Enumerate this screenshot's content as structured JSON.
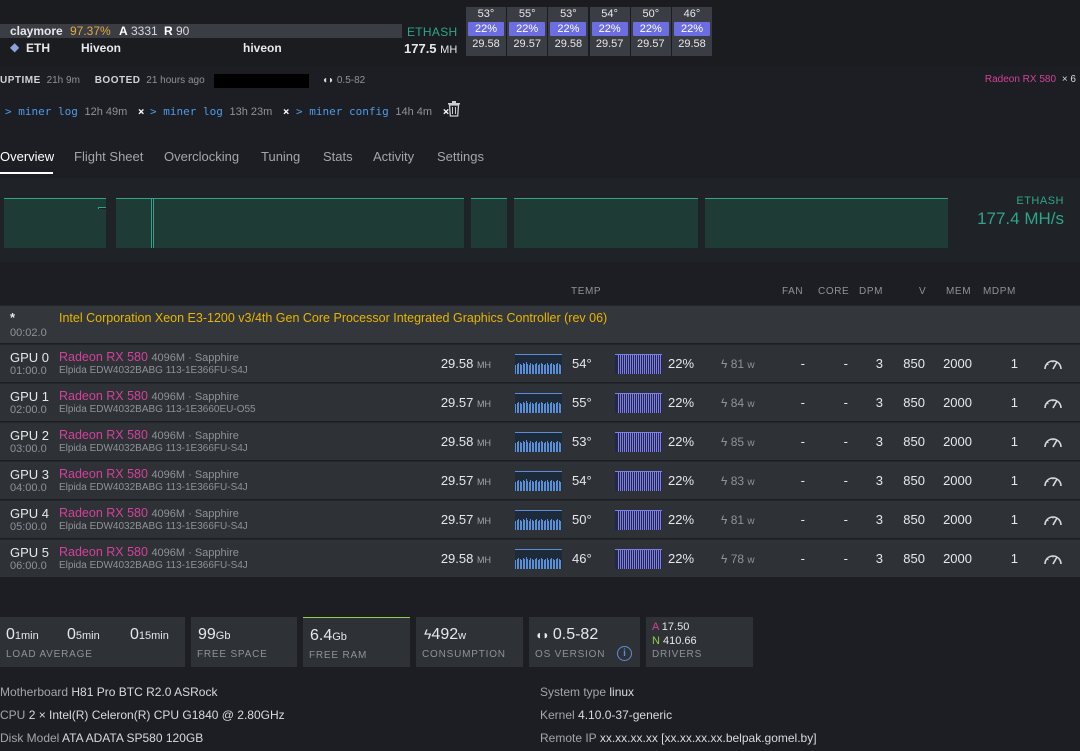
{
  "header": {
    "miner": "claymore",
    "miner_pct": "97.37%",
    "accepted_label": "A",
    "accepted": "3331",
    "rejected_label": "R",
    "rejected": "90",
    "coin": "ETH",
    "pool": "Hiveon",
    "wallet": "hiveon",
    "algo": "ETHASH",
    "hashrate": "177.5",
    "hashrate_unit": "MH"
  },
  "gpu_cards": [
    {
      "temp": "53°",
      "fan": "22%",
      "hash": "29.58"
    },
    {
      "temp": "55°",
      "fan": "22%",
      "hash": "29.57"
    },
    {
      "temp": "53°",
      "fan": "22%",
      "hash": "29.58"
    },
    {
      "temp": "54°",
      "fan": "22%",
      "hash": "29.57"
    },
    {
      "temp": "50°",
      "fan": "22%",
      "hash": "29.57"
    },
    {
      "temp": "46°",
      "fan": "22%",
      "hash": "29.58"
    }
  ],
  "status": {
    "uptime_label": "UPTIME",
    "uptime": "21h 9m",
    "booted_label": "BOOTED",
    "booted": "21 hours ago",
    "version": "0.5-82",
    "gpu_model": "Radeon RX 580",
    "gpu_count": "× 6"
  },
  "commands": [
    {
      "prefix": ">",
      "name": "miner log",
      "age": "12h 49m",
      "close": "×"
    },
    {
      "prefix": ">",
      "name": "miner log",
      "age": "13h 23m",
      "close": "×"
    },
    {
      "prefix": ">",
      "name": "miner config",
      "age": "14h 4m",
      "close": "×"
    }
  ],
  "tabs": [
    "Overview",
    "Flight Sheet",
    "Overclocking",
    "Tuning",
    "Stats",
    "Activity",
    "Settings"
  ],
  "hash_chart": {
    "algo": "ETHASH",
    "value": "177.4 MH/s"
  },
  "gpu_table": {
    "headers": {
      "temp": "TEMP",
      "fan": "FAN",
      "core": "CORE",
      "dpm": "DPM",
      "v": "V",
      "mem": "MEM",
      "mdpm": "MDPM"
    },
    "igpu": {
      "star": "*",
      "bus": "00:02.0",
      "name": "Intel Corporation Xeon E3-1200 v3/4th Gen Core Processor Integrated Graphics Controller (rev 06)"
    },
    "rows": [
      {
        "name": "GPU 0",
        "bus": "01:00.0",
        "model": "Radeon RX 580",
        "sub": "4096M · Sapphire",
        "mem": "Elpida EDW4032BABG 113-1E366FU-S4J",
        "hash": "29.58",
        "unit": "MH",
        "temp": "54°",
        "fan": "22%",
        "power": "81",
        "power_unit": "w",
        "fan_col": "-",
        "core_col": "-",
        "dpm": "3",
        "v": "850",
        "memclk": "2000",
        "mdpm": "1"
      },
      {
        "name": "GPU 1",
        "bus": "02:00.0",
        "model": "Radeon RX 580",
        "sub": "4096M · Sapphire",
        "mem": "Elpida EDW4032BABG 113-1E3660EU-O55",
        "hash": "29.57",
        "unit": "MH",
        "temp": "55°",
        "fan": "22%",
        "power": "84",
        "power_unit": "w",
        "fan_col": "-",
        "core_col": "-",
        "dpm": "3",
        "v": "850",
        "memclk": "2000",
        "mdpm": "1"
      },
      {
        "name": "GPU 2",
        "bus": "03:00.0",
        "model": "Radeon RX 580",
        "sub": "4096M · Sapphire",
        "mem": "Elpida EDW4032BABG 113-1E366FU-S4J",
        "hash": "29.58",
        "unit": "MH",
        "temp": "53°",
        "fan": "22%",
        "power": "85",
        "power_unit": "w",
        "fan_col": "-",
        "core_col": "-",
        "dpm": "3",
        "v": "850",
        "memclk": "2000",
        "mdpm": "1"
      },
      {
        "name": "GPU 3",
        "bus": "04:00.0",
        "model": "Radeon RX 580",
        "sub": "4096M · Sapphire",
        "mem": "Elpida EDW4032BABG 113-1E366FU-S4J",
        "hash": "29.57",
        "unit": "MH",
        "temp": "54°",
        "fan": "22%",
        "power": "83",
        "power_unit": "w",
        "fan_col": "-",
        "core_col": "-",
        "dpm": "3",
        "v": "850",
        "memclk": "2000",
        "mdpm": "1"
      },
      {
        "name": "GPU 4",
        "bus": "05:00.0",
        "model": "Radeon RX 580",
        "sub": "4096M · Sapphire",
        "mem": "Elpida EDW4032BABG 113-1E366FU-S4J",
        "hash": "29.57",
        "unit": "MH",
        "temp": "50°",
        "fan": "22%",
        "power": "81",
        "power_unit": "w",
        "fan_col": "-",
        "core_col": "-",
        "dpm": "3",
        "v": "850",
        "memclk": "2000",
        "mdpm": "1"
      },
      {
        "name": "GPU 5",
        "bus": "06:00.0",
        "model": "Radeon RX 580",
        "sub": "4096M · Sapphire",
        "mem": "Elpida EDW4032BABG 113-1E366FU-S4J",
        "hash": "29.58",
        "unit": "MH",
        "temp": "46°",
        "fan": "22%",
        "power": "78",
        "power_unit": "w",
        "fan_col": "-",
        "core_col": "-",
        "dpm": "3",
        "v": "850",
        "memclk": "2000",
        "mdpm": "1"
      }
    ]
  },
  "stats": {
    "load": [
      {
        "value": "0",
        "unit": "1min"
      },
      {
        "value": "0",
        "unit": "5min"
      },
      {
        "value": "0",
        "unit": "15min"
      }
    ],
    "load_label": "LOAD AVERAGE",
    "free_space": "99",
    "free_space_unit": "Gb",
    "free_space_label": "FREE SPACE",
    "free_ram": "6.4",
    "free_ram_unit": "Gb",
    "free_ram_label": "FREE RAM",
    "consumption": "492",
    "consumption_unit": "w",
    "consumption_label": "CONSUMPTION",
    "os_version": "0.5-82",
    "os_version_label": "OS VERSION",
    "drivers_a_label": "A",
    "drivers_a": "17.50",
    "drivers_n_label": "N",
    "drivers_n": "410.66",
    "drivers_label": "DRIVERS"
  },
  "system_info": {
    "motherboard_label": "Motherboard",
    "motherboard": "H81 Pro BTC R2.0 ASRock",
    "cpu_label": "CPU",
    "cpu": "2 × Intel(R) Celeron(R) CPU G1840 @ 2.80GHz",
    "disk_label": "Disk Model",
    "disk": "ATA ADATA SP580 120GB",
    "system_type_label": "System type",
    "system_type": "linux",
    "kernel_label": "Kernel",
    "kernel": "4.10.0-37-generic",
    "remote_ip_label": "Remote IP",
    "remote_ip": "xx.xx.xx.xx [xx.xx.xx.xx.belpak.gomel.by]"
  },
  "colors": {
    "accent_green": "#2ea58b",
    "gpu_magenta": "#d3419b",
    "fan_purple": "#6b6de0",
    "igpu_yellow": "#e8b600"
  }
}
